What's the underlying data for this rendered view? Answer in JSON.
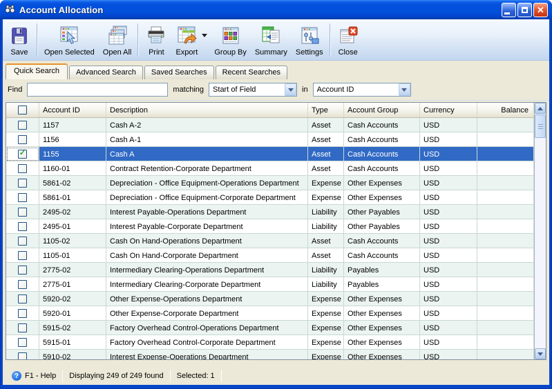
{
  "window": {
    "title": "Account Allocation"
  },
  "toolbar": {
    "buttons": [
      {
        "label": "Save"
      },
      {
        "label": "Open Selected"
      },
      {
        "label": "Open All"
      },
      {
        "label": "Print"
      },
      {
        "label": "Export",
        "has_dropdown": true
      },
      {
        "label": "Group By"
      },
      {
        "label": "Summary"
      },
      {
        "label": "Settings"
      },
      {
        "label": "Close"
      }
    ]
  },
  "tabs": {
    "items": [
      {
        "label": "Quick Search",
        "active": true
      },
      {
        "label": "Advanced Search",
        "active": false
      },
      {
        "label": "Saved Searches",
        "active": false
      },
      {
        "label": "Recent Searches",
        "active": false
      }
    ]
  },
  "search": {
    "find_label": "Find",
    "find_value": "",
    "matching_label": "matching",
    "matching_value": "Start of Field",
    "in_label": "in",
    "in_value": "Account ID"
  },
  "table": {
    "columns": [
      "",
      "Account ID",
      "Description",
      "Type",
      "Account Group",
      "Currency",
      "Balance"
    ],
    "rows": [
      {
        "checked": false,
        "selected": false,
        "account_id": "1157",
        "description": "Cash A-2",
        "type": "Asset",
        "account_group": "Cash Accounts",
        "currency": "USD",
        "balance": ""
      },
      {
        "checked": false,
        "selected": false,
        "account_id": "1156",
        "description": "Cash A-1",
        "type": "Asset",
        "account_group": "Cash Accounts",
        "currency": "USD",
        "balance": ""
      },
      {
        "checked": true,
        "selected": true,
        "account_id": "1155",
        "description": "Cash A",
        "type": "Asset",
        "account_group": "Cash Accounts",
        "currency": "USD",
        "balance": ""
      },
      {
        "checked": false,
        "selected": false,
        "account_id": "1160-01",
        "description": "Contract Retention-Corporate Department",
        "type": "Asset",
        "account_group": "Cash Accounts",
        "currency": "USD",
        "balance": ""
      },
      {
        "checked": false,
        "selected": false,
        "account_id": "5861-02",
        "description": "Depreciation - Office Equipment-Operations Department",
        "type": "Expense",
        "account_group": "Other Expenses",
        "currency": "USD",
        "balance": ""
      },
      {
        "checked": false,
        "selected": false,
        "account_id": "5861-01",
        "description": "Depreciation - Office Equipment-Corporate Department",
        "type": "Expense",
        "account_group": "Other Expenses",
        "currency": "USD",
        "balance": ""
      },
      {
        "checked": false,
        "selected": false,
        "account_id": "2495-02",
        "description": "Interest Payable-Operations Department",
        "type": "Liability",
        "account_group": "Other Payables",
        "currency": "USD",
        "balance": ""
      },
      {
        "checked": false,
        "selected": false,
        "account_id": "2495-01",
        "description": "Interest Payable-Corporate Department",
        "type": "Liability",
        "account_group": "Other Payables",
        "currency": "USD",
        "balance": ""
      },
      {
        "checked": false,
        "selected": false,
        "account_id": "1105-02",
        "description": "Cash On Hand-Operations Department",
        "type": "Asset",
        "account_group": "Cash Accounts",
        "currency": "USD",
        "balance": ""
      },
      {
        "checked": false,
        "selected": false,
        "account_id": "1105-01",
        "description": "Cash On Hand-Corporate Department",
        "type": "Asset",
        "account_group": "Cash Accounts",
        "currency": "USD",
        "balance": ""
      },
      {
        "checked": false,
        "selected": false,
        "account_id": "2775-02",
        "description": "Intermediary Clearing-Operations Department",
        "type": "Liability",
        "account_group": "Payables",
        "currency": "USD",
        "balance": ""
      },
      {
        "checked": false,
        "selected": false,
        "account_id": "2775-01",
        "description": "Intermediary Clearing-Corporate Department",
        "type": "Liability",
        "account_group": "Payables",
        "currency": "USD",
        "balance": ""
      },
      {
        "checked": false,
        "selected": false,
        "account_id": "5920-02",
        "description": "Other Expense-Operations Department",
        "type": "Expense",
        "account_group": "Other Expenses",
        "currency": "USD",
        "balance": ""
      },
      {
        "checked": false,
        "selected": false,
        "account_id": "5920-01",
        "description": "Other Expense-Corporate Department",
        "type": "Expense",
        "account_group": "Other Expenses",
        "currency": "USD",
        "balance": ""
      },
      {
        "checked": false,
        "selected": false,
        "account_id": "5915-02",
        "description": "Factory Overhead Control-Operations Department",
        "type": "Expense",
        "account_group": "Other Expenses",
        "currency": "USD",
        "balance": ""
      },
      {
        "checked": false,
        "selected": false,
        "account_id": "5915-01",
        "description": "Factory Overhead Control-Corporate Department",
        "type": "Expense",
        "account_group": "Other Expenses",
        "currency": "USD",
        "balance": ""
      },
      {
        "checked": false,
        "selected": false,
        "account_id": "5910-02",
        "description": "Interest Expense-Operations Department",
        "type": "Expense",
        "account_group": "Other Expenses",
        "currency": "USD",
        "balance": ""
      }
    ]
  },
  "status": {
    "help": "F1 - Help",
    "help_glyph": "?",
    "displaying": "Displaying 249 of 249 found",
    "selected": "Selected: 1"
  },
  "colors": {
    "selection": "#316AC5",
    "titlebar": "#0350DC",
    "active_tab_accent": "#E8932C"
  }
}
